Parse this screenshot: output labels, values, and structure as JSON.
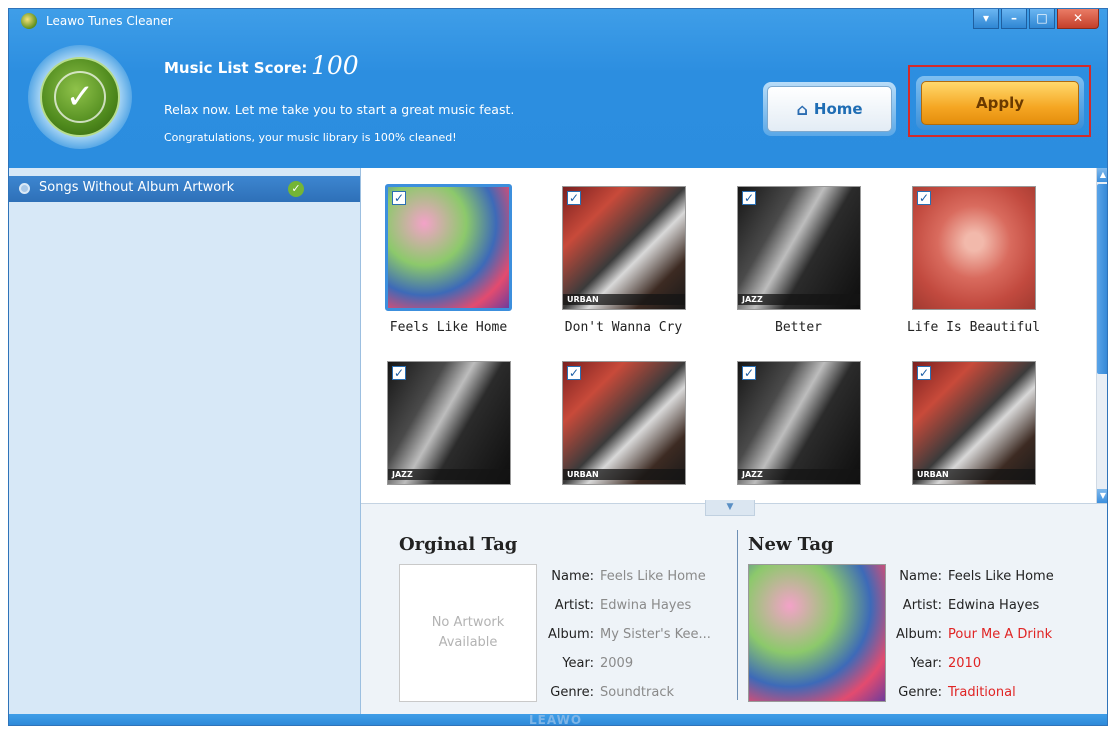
{
  "window": {
    "title": "Leawo Tunes Cleaner"
  },
  "header": {
    "score_label": "Music List Score:",
    "score_value": "100",
    "message": "Relax now. Let me take you to start a great music feast.",
    "congrats": "Congratulations, your music library is 100% cleaned!",
    "home_label": "Home",
    "apply_label": "Apply"
  },
  "sidebar": {
    "items": [
      {
        "label": "Songs Without Album Artwork"
      }
    ]
  },
  "grid": {
    "songs": [
      {
        "title": "Feels Like Home",
        "genre_badge": "",
        "checked": true,
        "selected": true,
        "art": "pop"
      },
      {
        "title": "Don't Wanna Cry",
        "genre_badge": "URBAN",
        "checked": true,
        "selected": false,
        "art": "urban"
      },
      {
        "title": "Better",
        "genre_badge": "JAZZ",
        "checked": true,
        "selected": false,
        "art": "jazz"
      },
      {
        "title": "Life Is Beautiful",
        "genre_badge": "",
        "checked": true,
        "selected": false,
        "art": "life"
      },
      {
        "title": "",
        "genre_badge": "JAZZ",
        "checked": true,
        "selected": false,
        "art": "jazz"
      },
      {
        "title": "",
        "genre_badge": "URBAN",
        "checked": true,
        "selected": false,
        "art": "urban"
      },
      {
        "title": "",
        "genre_badge": "JAZZ",
        "checked": true,
        "selected": false,
        "art": "jazz"
      },
      {
        "title": "",
        "genre_badge": "URBAN",
        "checked": true,
        "selected": false,
        "art": "urban"
      }
    ]
  },
  "original_tag": {
    "title": "Orginal Tag",
    "no_artwork": "No Artwork Available",
    "fields": [
      {
        "key": "Name:",
        "value": "Feels Like Home"
      },
      {
        "key": "Artist:",
        "value": "Edwina Hayes"
      },
      {
        "key": "Album:",
        "value": "My Sister's Kee..."
      },
      {
        "key": "Year:",
        "value": "2009"
      },
      {
        "key": "Genre:",
        "value": "Soundtrack"
      }
    ]
  },
  "new_tag": {
    "title": "New Tag",
    "fields": [
      {
        "key": "Name:",
        "value": "Feels Like Home",
        "changed": false
      },
      {
        "key": "Artist:",
        "value": "Edwina Hayes",
        "changed": false
      },
      {
        "key": "Album:",
        "value": "Pour Me A Drink",
        "changed": true
      },
      {
        "key": "Year:",
        "value": "2010",
        "changed": true
      },
      {
        "key": "Genre:",
        "value": "Traditional",
        "changed": true
      }
    ]
  },
  "footer": {
    "logo": "LEAWO"
  },
  "colors": {
    "accent": "#2c8ee0",
    "changed_value": "#e02424",
    "apply": "#f5a623",
    "highlight": "#d32a2a"
  },
  "icons": {
    "home": "home-icon",
    "check": "check-icon",
    "minimize": "minimize-icon",
    "maximize": "maximize-icon",
    "close": "close-icon",
    "dropdown": "dropdown-icon"
  }
}
